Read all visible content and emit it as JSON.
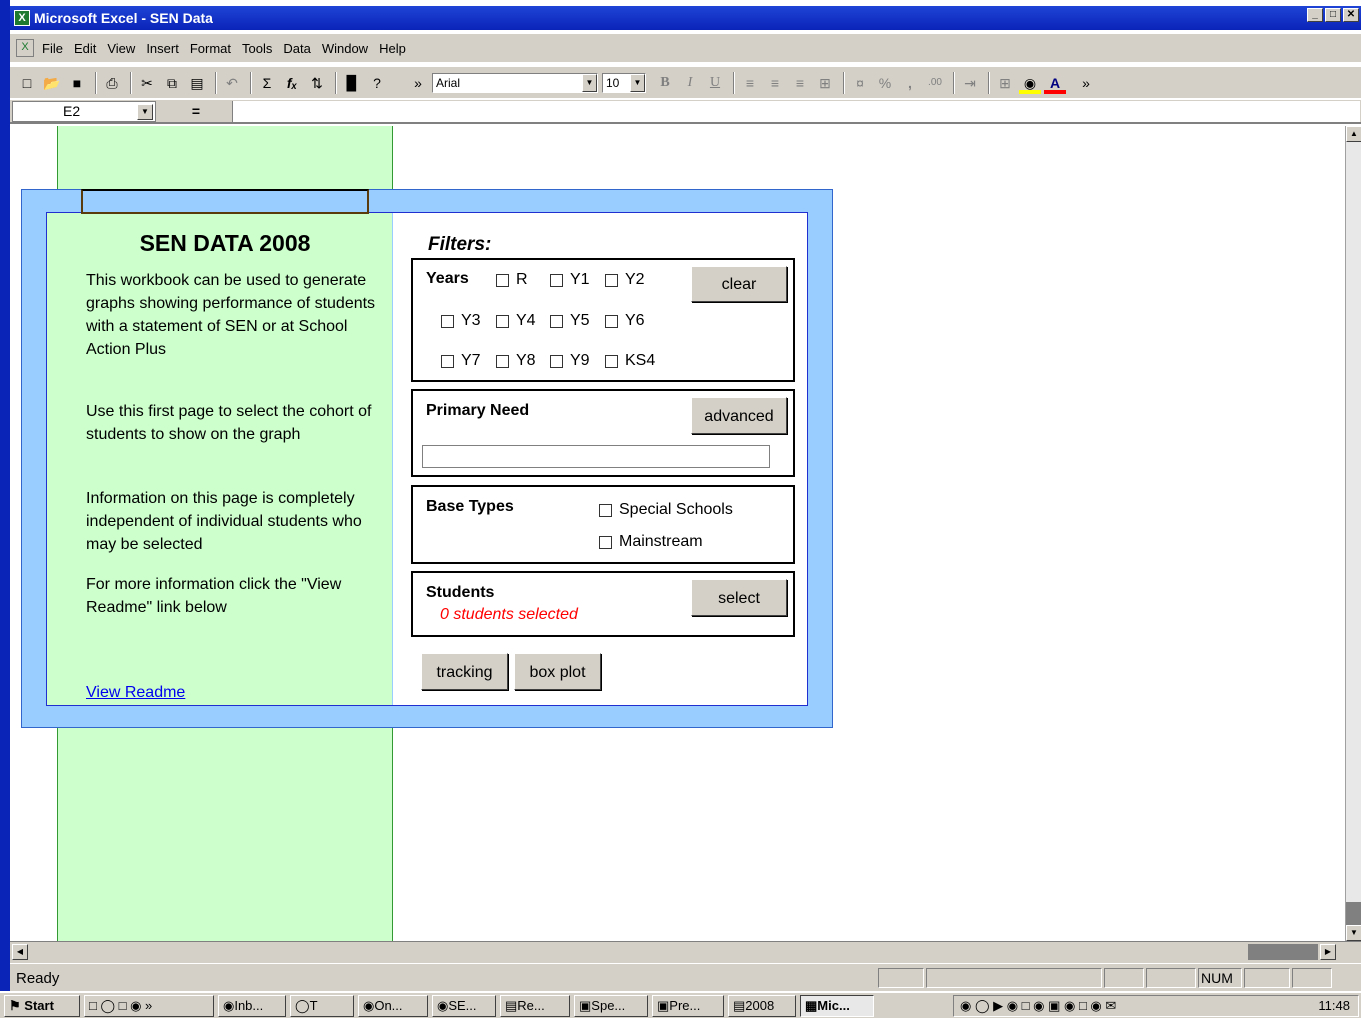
{
  "window": {
    "title": "Microsoft Excel - SEN Data",
    "min": "_",
    "max": "□",
    "close": "✕"
  },
  "menu": {
    "items": [
      "File",
      "Edit",
      "View",
      "Insert",
      "Format",
      "Tools",
      "Data",
      "Window",
      "Help"
    ]
  },
  "toolbar": {
    "font": "Arial",
    "size": "10",
    "bold": "B",
    "italic": "I",
    "underline": "U",
    "percent": "%",
    "comma": ",",
    "sum": "Σ",
    "fx": "fₓ"
  },
  "formula_bar": {
    "cell_ref": "E2",
    "equals": "=",
    "content": ""
  },
  "sheet": {
    "heading": "SEN DATA 2008",
    "paragraphs": [
      "This workbook can be used to generate graphs showing performance of students with a statement of SEN or at School Action Plus",
      "Use this first page to select the cohort of students to show on the graph",
      "Information on this page is completely independent of individual students who may be selected",
      "For more information click the \"View Readme\" link below"
    ],
    "readme_link": "View Readme",
    "filters_title": "Filters:",
    "years": {
      "label": "Years",
      "options": [
        "R",
        "Y1",
        "Y2",
        "Y3",
        "Y4",
        "Y5",
        "Y6",
        "Y7",
        "Y8",
        "Y9",
        "KS4"
      ],
      "clear_button": "clear"
    },
    "primary_need": {
      "label": "Primary Need",
      "advanced_button": "advanced",
      "value": ""
    },
    "base_types": {
      "label": "Base Types",
      "options": [
        "Special Schools",
        "Mainstream"
      ]
    },
    "students": {
      "label": "Students",
      "status": "0 students selected",
      "select_button": "select"
    },
    "buttons": {
      "tracking": "tracking",
      "box_plot": "box plot"
    }
  },
  "status": {
    "text": "Ready",
    "num": "NUM"
  },
  "taskbar": {
    "start": "Start",
    "items": [
      "Inb...",
      "T",
      "On...",
      "SE...",
      "Re...",
      "Spe...",
      "Pre...",
      "2008",
      "Mic..."
    ],
    "clock": "11:48"
  },
  "colors": {
    "frame_blue": "#99ccff",
    "panel_green": "#ccffcc",
    "title_blue": "#0a24b8",
    "link": "#0000ee",
    "alert_red": "#ff0000"
  }
}
